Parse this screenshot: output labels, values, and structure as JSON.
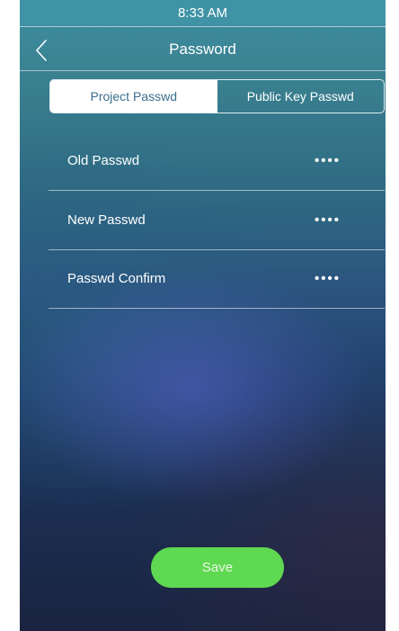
{
  "status_bar": {
    "time": "8:33 AM"
  },
  "header": {
    "title": "Password",
    "back_icon": "chevron-left-icon"
  },
  "tabs": [
    {
      "label": "Project Passwd",
      "active": true
    },
    {
      "label": "Public Key Passwd",
      "active": false
    }
  ],
  "fields": [
    {
      "label": "Old Passwd",
      "value": "••••"
    },
    {
      "label": "New Passwd",
      "value": "••••"
    },
    {
      "label": "Passwd Confirm",
      "value": "••••"
    }
  ],
  "actions": {
    "save_label": "Save"
  },
  "colors": {
    "save_button": "#5fd852",
    "active_tab_bg": "#ffffff",
    "active_tab_text": "#3a6f8d"
  }
}
